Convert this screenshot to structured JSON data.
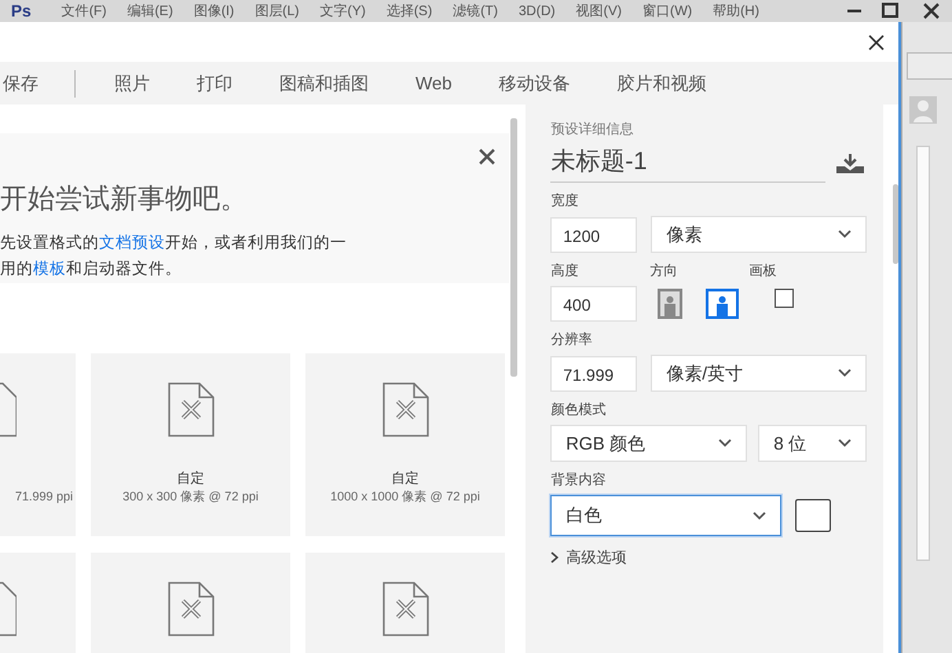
{
  "app_menu": {
    "logo": "Ps",
    "items": [
      "文件(F)",
      "编辑(E)",
      "图像(I)",
      "图层(L)",
      "文字(Y)",
      "选择(S)",
      "滤镜(T)",
      "3D(D)",
      "视图(V)",
      "窗口(W)",
      "帮助(H)"
    ]
  },
  "dialog": {
    "tabs": [
      {
        "label": "保存",
        "selected": false
      },
      {
        "label": "照片",
        "selected": false
      },
      {
        "label": "打印",
        "selected": false
      },
      {
        "label": "图稿和插图",
        "selected": false
      },
      {
        "label": "Web",
        "selected": false
      },
      {
        "label": "移动设备",
        "selected": false
      },
      {
        "label": "胶片和视频",
        "selected": false
      }
    ],
    "welcome": {
      "title": "开始尝试新事物吧。",
      "lines": [
        [
          {
            "kind": "text",
            "text": "先设置格式的"
          },
          {
            "kind": "link",
            "text": "文档预设"
          },
          {
            "kind": "text",
            "text": "开始，或者利用我们的一"
          }
        ],
        [
          {
            "kind": "text",
            "text": "用的"
          },
          {
            "kind": "link",
            "text": "模板"
          },
          {
            "kind": "text",
            "text": "和启动器文件。"
          }
        ]
      ]
    },
    "presets": [
      [
        {
          "kind": "partial",
          "size": "71.999 ppi"
        },
        {
          "kind": "full",
          "name": "自定",
          "size": "300 x 300 像素 @ 72 ppi"
        },
        {
          "kind": "full",
          "name": "自定",
          "size": "1000 x 1000 像素 @ 72 ppi"
        }
      ],
      [
        {
          "kind": "partial"
        },
        {
          "kind": "full"
        },
        {
          "kind": "full"
        }
      ]
    ],
    "details": {
      "title": "预设详细信息",
      "doc_name": "未标题-1",
      "width": {
        "label": "宽度",
        "value": "1200",
        "unit": "像素"
      },
      "height": {
        "label": "高度",
        "value": "400"
      },
      "orientation": {
        "label": "方向",
        "options": [
          {
            "kind": "portrait",
            "selected": false
          },
          {
            "kind": "landscape",
            "selected": true
          }
        ]
      },
      "artboard": {
        "label": "画板",
        "checked": false
      },
      "resolution": {
        "label": "分辨率",
        "value": "71.999",
        "unit": "像素/英寸"
      },
      "color_mode": {
        "label": "颜色模式",
        "mode": "RGB 颜色",
        "depth": "8 位"
      },
      "background": {
        "label": "背景内容",
        "value": "白色",
        "focused": true
      },
      "advanced": {
        "label": "高级选项",
        "expanded": false
      }
    }
  }
}
